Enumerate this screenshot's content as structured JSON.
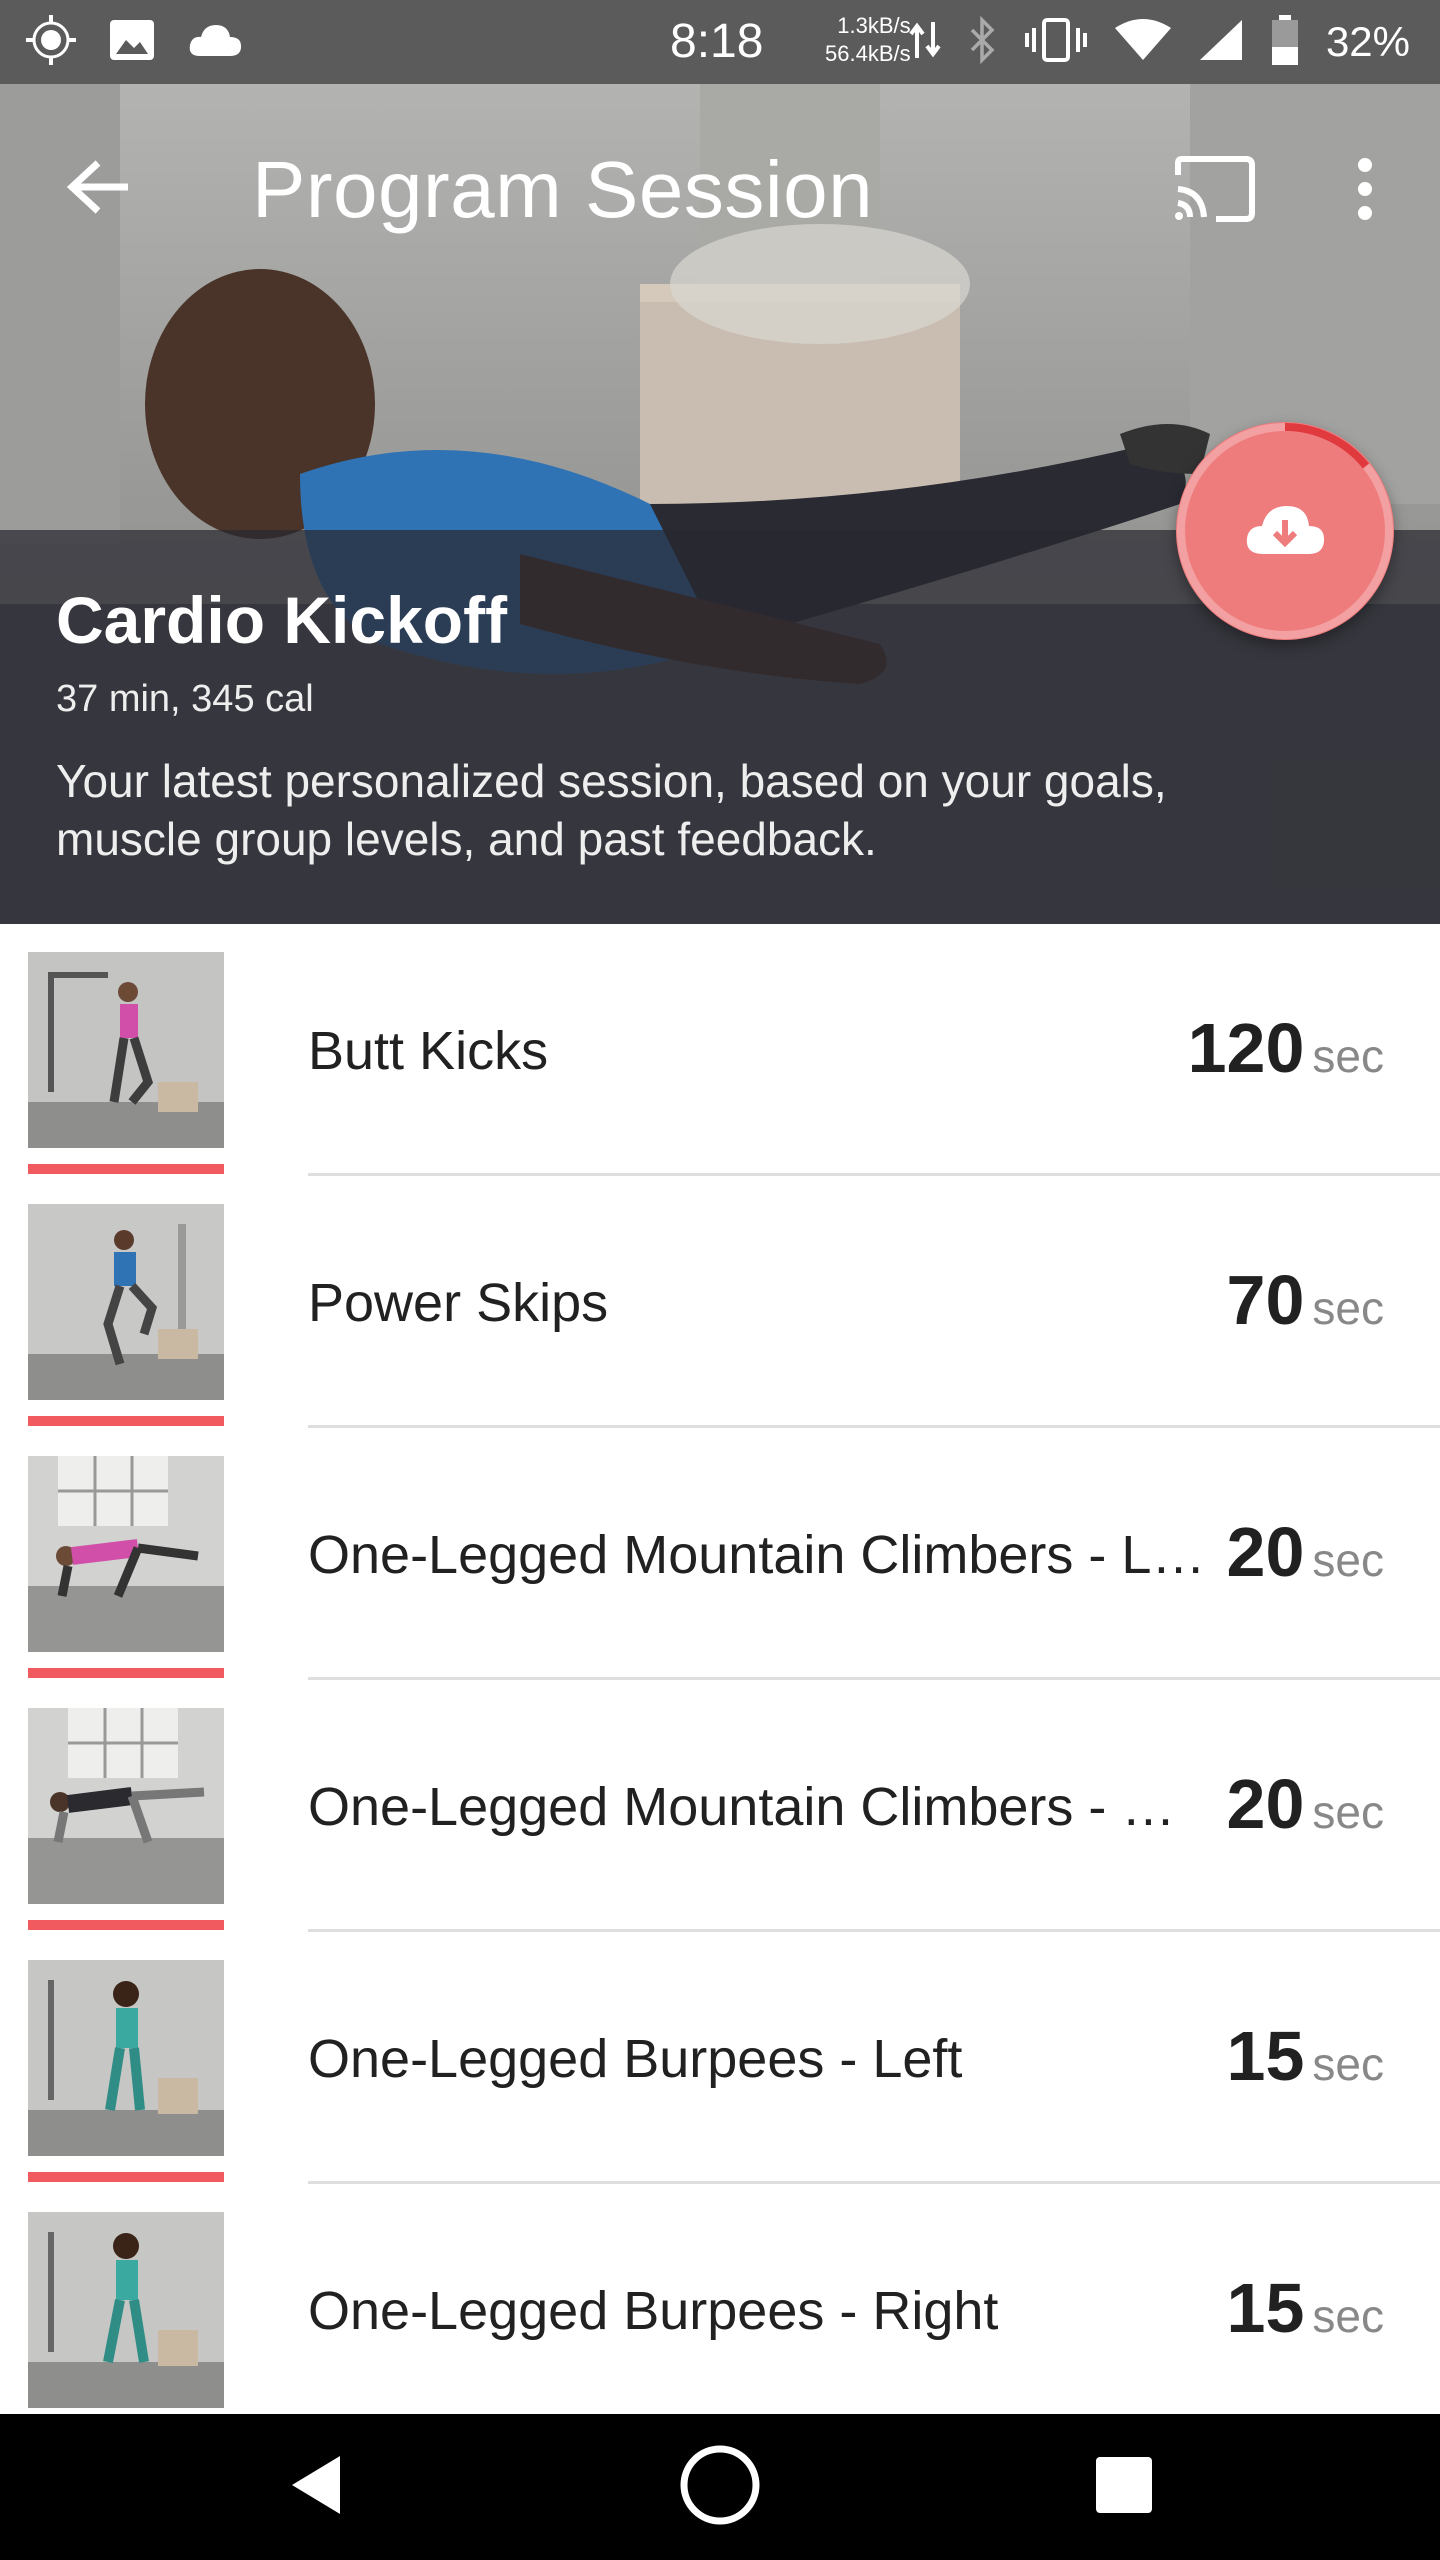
{
  "status_bar": {
    "time": "8:18",
    "rate_up": "1.3kB/s",
    "rate_down": "56.4kB/s",
    "battery": "32%"
  },
  "toolbar": {
    "title": "Program Session",
    "back_icon": "arrow-left-icon",
    "cast_icon": "cast-icon",
    "more_icon": "more-vert-icon"
  },
  "session": {
    "title": "Cardio Kickoff",
    "meta": "37 min, 345 cal",
    "description": "Your latest personalized session, based on your goals, muscle group levels, and past feedback.",
    "download_icon": "cloud-download-icon"
  },
  "colors": {
    "accent": "#f15a5f",
    "fab": "#ef7c7d"
  },
  "exercises": [
    {
      "name": "Butt Kicks",
      "value": "120",
      "unit": "sec"
    },
    {
      "name": "Power Skips",
      "value": "70",
      "unit": "sec"
    },
    {
      "name": "One-Legged Mountain Climbers - Left",
      "value": "20",
      "unit": "sec"
    },
    {
      "name": "One-Legged Mountain Climbers - Right",
      "value": "20",
      "unit": "sec"
    },
    {
      "name": "One-Legged Burpees - Left",
      "value": "15",
      "unit": "sec"
    },
    {
      "name": "One-Legged Burpees - Right",
      "value": "15",
      "unit": "sec"
    }
  ],
  "navbar": {
    "back_icon": "nav-back-icon",
    "home_icon": "nav-home-icon",
    "recents_icon": "nav-recents-icon"
  }
}
